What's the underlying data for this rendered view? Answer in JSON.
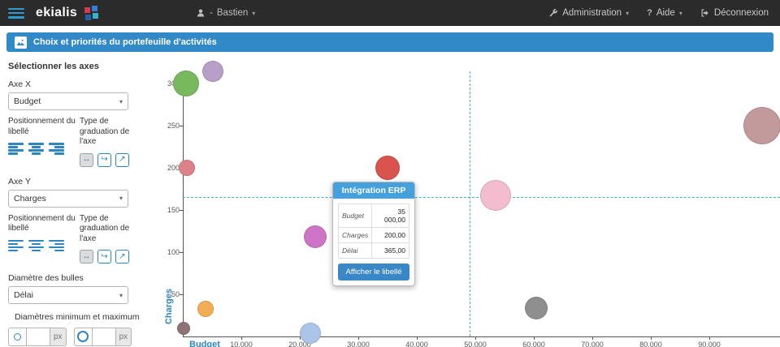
{
  "navbar": {
    "brand": "ekialis",
    "user_sep": "-",
    "user_name": "Bastien",
    "admin_label": "Administration",
    "help_q": "?",
    "help_label": "Aide",
    "logout_label": "Déconnexion"
  },
  "header": {
    "title": "Choix et priorités du portefeuille d'activités"
  },
  "sidebar": {
    "section_title": "Sélectionner les axes",
    "axe_x": {
      "label": "Axe X",
      "value": "Budget"
    },
    "axe_y": {
      "label": "Axe Y",
      "value": "Charges"
    },
    "positionnement_label": "Positionnement du libellé",
    "graduation_label": "Type de graduation de l'axe",
    "bubble_diameter": {
      "label": "Diamètre des bulles",
      "value": "Délai"
    },
    "minmax_label": "Diamètres minimum et maximum",
    "px_label": "px",
    "graduation_icons": [
      "↔",
      "↪",
      "↗"
    ]
  },
  "tooltip": {
    "title": "Intégration ERP",
    "rows": [
      {
        "label": "Budget",
        "value": "35 000,00"
      },
      {
        "label": "Charges",
        "value": "200,00"
      },
      {
        "label": "Délai",
        "value": "365,00"
      }
    ],
    "button_label": "Afficher le libellé"
  },
  "chart_data": {
    "type": "scatter",
    "title": "",
    "xlabel": "Budget",
    "ylabel": "Charges",
    "xlim": [
      0,
      102000
    ],
    "ylim": [
      0,
      315
    ],
    "grid": false,
    "x_ticks": [
      10000,
      20000,
      30000,
      40000,
      50000,
      60000,
      70000,
      80000,
      90000
    ],
    "x_tick_labels": [
      "10,000",
      "20,000",
      "30,000",
      "40,000",
      "50,000",
      "60,000",
      "70,000",
      "80,000",
      "90,000"
    ],
    "y_ticks": [
      50,
      100,
      150,
      200,
      250,
      300
    ],
    "crosshair": {
      "x": 49000,
      "y": 165,
      "color": "#3fb4c4"
    },
    "bubbles": [
      {
        "name": "bubble-green",
        "x": 500,
        "y": 300,
        "r": 16,
        "color": "#79b95e"
      },
      {
        "name": "bubble-purple",
        "x": 5100,
        "y": 314,
        "r": 13,
        "color": "#b79fc7"
      },
      {
        "name": "bubble-small-red",
        "x": 700,
        "y": 200,
        "r": 10,
        "color": "#dd8289"
      },
      {
        "name": "bubble-erp",
        "x": 35000,
        "y": 200,
        "r": 15,
        "color": "#d9534f",
        "label": "Intégration ERP"
      },
      {
        "name": "bubble-orchid",
        "x": 22600,
        "y": 118,
        "r": 14,
        "color": "#cd74c6"
      },
      {
        "name": "bubble-pink",
        "x": 53500,
        "y": 167,
        "r": 19,
        "color": "#f4bccf"
      },
      {
        "name": "bubble-mauve",
        "x": 99000,
        "y": 250,
        "r": 23,
        "color": "#c29a9c"
      },
      {
        "name": "bubble-gray",
        "x": 60400,
        "y": 34,
        "r": 14,
        "color": "#8f8f8f"
      },
      {
        "name": "bubble-orange",
        "x": 3900,
        "y": 33,
        "r": 10,
        "color": "#f3ad54"
      },
      {
        "name": "bubble-lightblue",
        "x": 21800,
        "y": 4,
        "r": 13,
        "color": "#abc4e8"
      },
      {
        "name": "bubble-darkmauve",
        "x": 200,
        "y": 10,
        "r": 8,
        "color": "#8d7276"
      }
    ]
  }
}
